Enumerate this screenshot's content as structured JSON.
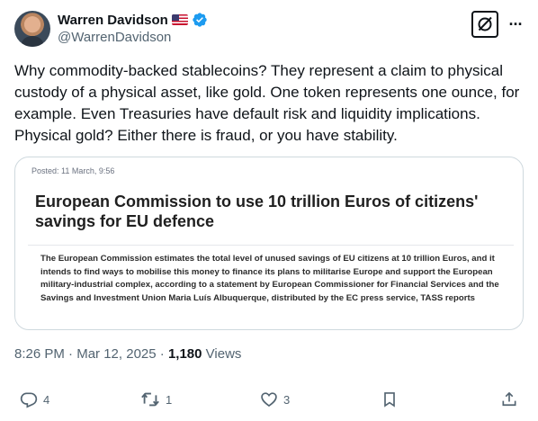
{
  "author": {
    "name": "Warren Davidson",
    "handle": "@WarrenDavidson",
    "flag_icon": "us-flag-icon",
    "verified_icon": "verified-badge-icon"
  },
  "header_actions": {
    "grok_icon": "grok-icon",
    "more_label": "···"
  },
  "tweet": {
    "text": "Why commodity-backed stablecoins? They represent a claim to physical custody of a physical asset, like gold. One token represents one ounce, for example. Even Treasuries have default risk and liquidity implications. Physical gold? Either there is fraud, or you have stability."
  },
  "card": {
    "posted": "Posted: 11 March, 9:56",
    "headline": "European Commission to use 10 trillion Euros of citizens' savings for EU defence",
    "body": "The European Commission estimates the total level of unused savings of EU citizens at 10 trillion Euros, and it intends to find ways to mobilise this money to finance its plans to militarise Europe and support the European military-industrial complex, according to a statement by European Commissioner for Financial Services and the Savings and Investment Union Maria Luís Albuquerque, distributed by the EC press service, TASS reports"
  },
  "meta": {
    "time": "8:26 PM",
    "date": "Mar 12, 2025",
    "views_count": "1,180",
    "views_label": "Views",
    "separator": "·"
  },
  "actions": {
    "reply_count": "4",
    "repost_count": "1",
    "like_count": "3",
    "colors": {
      "icon": "#536471"
    }
  },
  "colors": {
    "verified": "#1d9bf0",
    "text": "#0f1419",
    "muted": "#536471",
    "border": "#cfd9de"
  }
}
